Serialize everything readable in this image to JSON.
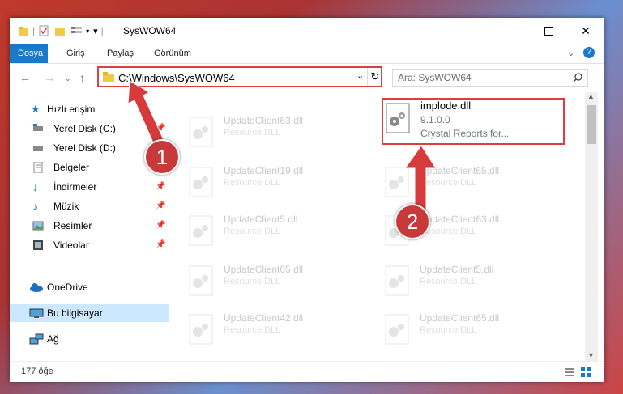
{
  "window": {
    "title": "SysWOW64"
  },
  "ribbon": {
    "tabs": [
      "Dosya",
      "Giriş",
      "Paylaş",
      "Görünüm"
    ],
    "help": "?"
  },
  "address": {
    "path": "C:\\Windows\\SysWOW64"
  },
  "search": {
    "placeholder": "Ara: SysWOW64"
  },
  "sidebar": {
    "quick_access": "Hızlı erişim",
    "items": [
      {
        "label": "Yerel Disk (C:)"
      },
      {
        "label": "Yerel Disk (D:)"
      },
      {
        "label": "Belgeler"
      },
      {
        "label": "İndirmeler"
      },
      {
        "label": "Müzik"
      },
      {
        "label": "Resimler"
      },
      {
        "label": "Videolar"
      }
    ],
    "onedrive": "OneDrive",
    "this_pc": "Bu bilgisayar",
    "network": "Ağ"
  },
  "files": {
    "left": [
      {
        "name": "UpdateClient63.dll",
        "desc": "Resource DLL"
      },
      {
        "name": "UpdateClient19.dll",
        "desc": "Resource DLL"
      },
      {
        "name": "UpdateClient5.dll",
        "desc": "Resource DLL"
      },
      {
        "name": "UpdateClient65.dll",
        "desc": "Resource DLL"
      },
      {
        "name": "UpdateClient42.dll",
        "desc": "Resource DLL"
      }
    ],
    "right": [
      {
        "name": "UpdateClient65.dll",
        "desc": "Resource DLL"
      },
      {
        "name": "UpdateClient63.dll",
        "desc": "Resource DLL"
      },
      {
        "name": "UpdateClient5.dll",
        "desc": "Resource DLL"
      },
      {
        "name": "UpdateClient65.dll",
        "desc": "Resource DLL"
      }
    ],
    "highlighted": {
      "name": "implode.dll",
      "version": "9.1.0.0",
      "desc": "Crystal Reports for..."
    }
  },
  "status": {
    "count": "177 öğe"
  },
  "callouts": [
    "1",
    "2"
  ],
  "colors": {
    "accent": "#1979ca",
    "highlight": "#d94040"
  }
}
